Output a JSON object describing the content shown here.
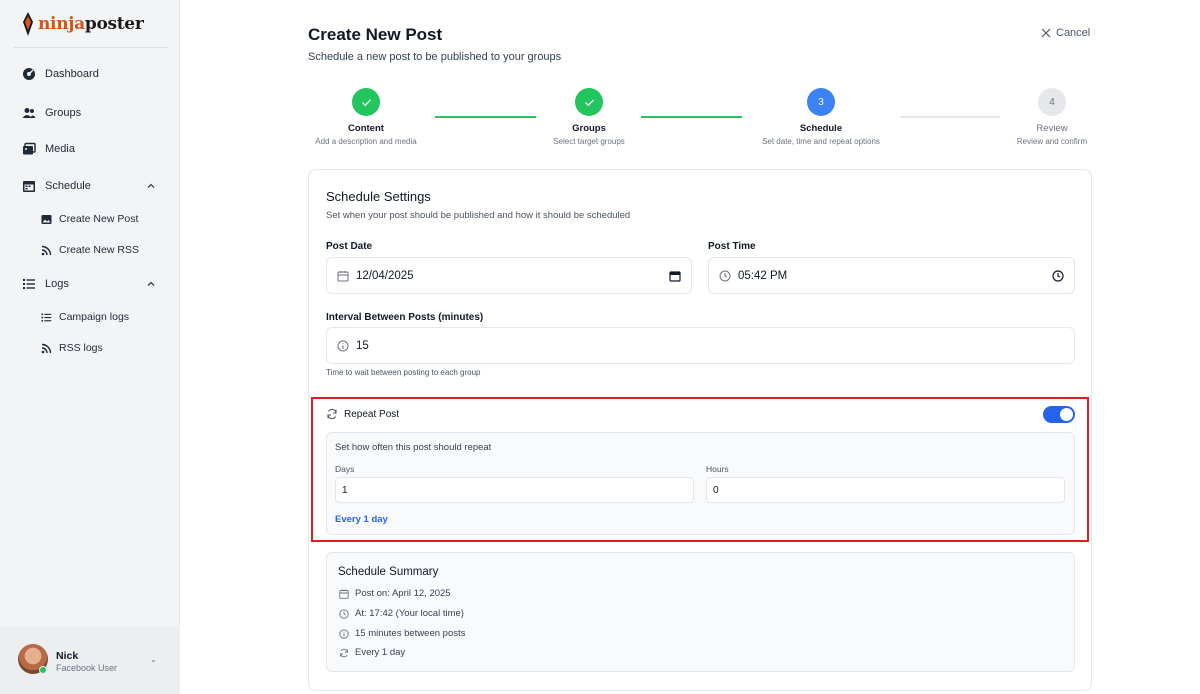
{
  "brand": {
    "logo_part1": "ninja",
    "logo_part2": "poster"
  },
  "sidebar": {
    "items": [
      {
        "label": "Dashboard",
        "icon": "dashboard-icon"
      },
      {
        "label": "Groups",
        "icon": "users-icon"
      },
      {
        "label": "Media",
        "icon": "media-icon"
      },
      {
        "label": "Schedule",
        "icon": "calendar-icon",
        "expanded": true,
        "children": [
          {
            "label": "Create New Post",
            "icon": "image-icon"
          },
          {
            "label": "Create New RSS",
            "icon": "rss-icon"
          }
        ]
      },
      {
        "label": "Logs",
        "icon": "list-icon",
        "expanded": true,
        "children": [
          {
            "label": "Campaign logs",
            "icon": "list-icon"
          },
          {
            "label": "RSS logs",
            "icon": "rss-icon"
          }
        ]
      }
    ]
  },
  "user": {
    "name": "Nick",
    "role": "Facebook User",
    "status_color": "#22c55e"
  },
  "header": {
    "title": "Create New Post",
    "subtitle": "Schedule a new post to be published to your groups",
    "cancel_label": "Cancel"
  },
  "stepper": {
    "steps": [
      {
        "number": "1",
        "title": "Content",
        "description": "Add a description and media",
        "status": "done"
      },
      {
        "number": "2",
        "title": "Groups",
        "description": "Select target groups",
        "status": "done"
      },
      {
        "number": "3",
        "title": "Schedule",
        "description": "Set date, time and repeat options",
        "status": "active"
      },
      {
        "number": "4",
        "title": "Review",
        "description": "Review and confirm",
        "status": "pending"
      }
    ]
  },
  "schedule": {
    "title": "Schedule Settings",
    "subtitle": "Set when your post should be published and how it should be scheduled",
    "post_date_label": "Post Date",
    "post_date_value": "12/04/2025",
    "post_time_label": "Post Time",
    "post_time_value": "05:42 PM",
    "interval_label": "Interval Between Posts (minutes)",
    "interval_value": "15",
    "interval_help": "Time to wait between posting to each group",
    "repeat_label": "Repeat Post",
    "repeat_enabled": true,
    "repeat_description": "Set how often this post should repeat",
    "days_label": "Days",
    "days_value": "1",
    "hours_label": "Hours",
    "hours_value": "0",
    "repeat_summary": "Every 1 day"
  },
  "summary": {
    "title": "Schedule Summary",
    "rows": [
      {
        "icon": "calendar-icon",
        "text": "Post on: April 12, 2025"
      },
      {
        "icon": "clock-icon",
        "text": "At: 17:42 (Your local time)"
      },
      {
        "icon": "info-icon",
        "text": "15 minutes between posts"
      },
      {
        "icon": "repeat-icon",
        "text": "Every 1 day"
      }
    ]
  },
  "colors": {
    "accent": "#2563eb",
    "success": "#22c55e",
    "highlight": "#e11d24",
    "brand_orange": "#d9531e"
  }
}
